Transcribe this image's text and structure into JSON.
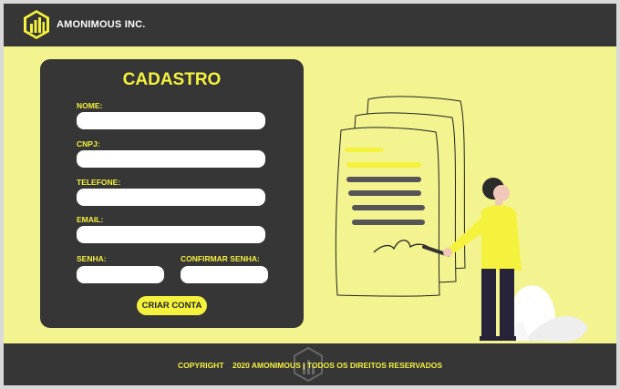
{
  "header": {
    "company": "AMONIMOUS INC.",
    "logo_icon": "bar-chart-logo-icon"
  },
  "form": {
    "title": "CADASTRO",
    "fields": {
      "nome": {
        "label": "NOME:",
        "value": ""
      },
      "cnpj": {
        "label": "CNPJ:",
        "value": ""
      },
      "telefone": {
        "label": "TELEFONE:",
        "value": ""
      },
      "email": {
        "label": "EMAIL:",
        "value": ""
      },
      "senha": {
        "label": "SENHA:",
        "value": ""
      },
      "confirmar_senha": {
        "label": "CONFIRMAR SENHA:",
        "value": ""
      }
    },
    "submit_label": "CRIAR CONTA"
  },
  "illustration": {
    "name": "person-signing-document-illustration"
  },
  "footer": {
    "text": "COPYRIGHT    2020 AMONIMOUS | TODOS OS DIREITOS RESERVADOS",
    "logo_icon": "hexagon-logo-icon"
  },
  "colors": {
    "dark": "#363636",
    "accent": "#f5f23e",
    "background": "#f3f38f"
  }
}
